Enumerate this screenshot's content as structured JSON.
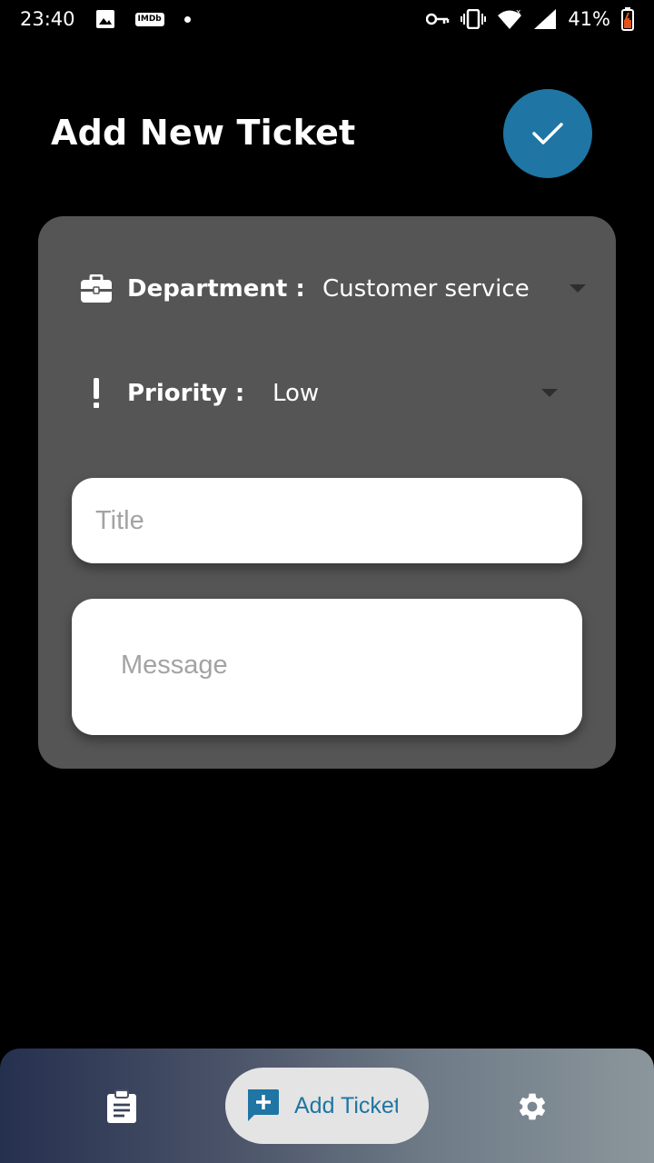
{
  "status_bar": {
    "time": "23:40",
    "left_icons": [
      "image-icon",
      "imdb-icon",
      "notification-dot-icon"
    ],
    "imdb_text": "IMDb",
    "right_icons": [
      "vpn-key-icon",
      "vibrate-icon",
      "wifi-icon",
      "signal-icon",
      "battery-icon"
    ],
    "battery": "41%"
  },
  "header": {
    "title": "Add New Ticket",
    "confirm_icon": "check-icon"
  },
  "form": {
    "department": {
      "icon": "briefcase-icon",
      "label": "Department :",
      "value": "Customer service"
    },
    "priority": {
      "icon": "exclamation-icon",
      "label": "Priority :",
      "value": "Low"
    },
    "title_input": {
      "placeholder": "Title",
      "value": ""
    },
    "message_input": {
      "placeholder": "Message",
      "value": ""
    }
  },
  "bottom_nav": {
    "items": [
      {
        "icon": "clipboard-list-icon",
        "label": ""
      },
      {
        "icon": "add-comment-icon",
        "label": "Add Ticket",
        "active": true
      },
      {
        "icon": "gear-icon",
        "label": ""
      }
    ]
  },
  "colors": {
    "accent": "#1f75a3",
    "card_bg": "#555555",
    "background": "#000000",
    "nav_gradient_start": "#25304f",
    "nav_gradient_end": "#8b969c"
  }
}
